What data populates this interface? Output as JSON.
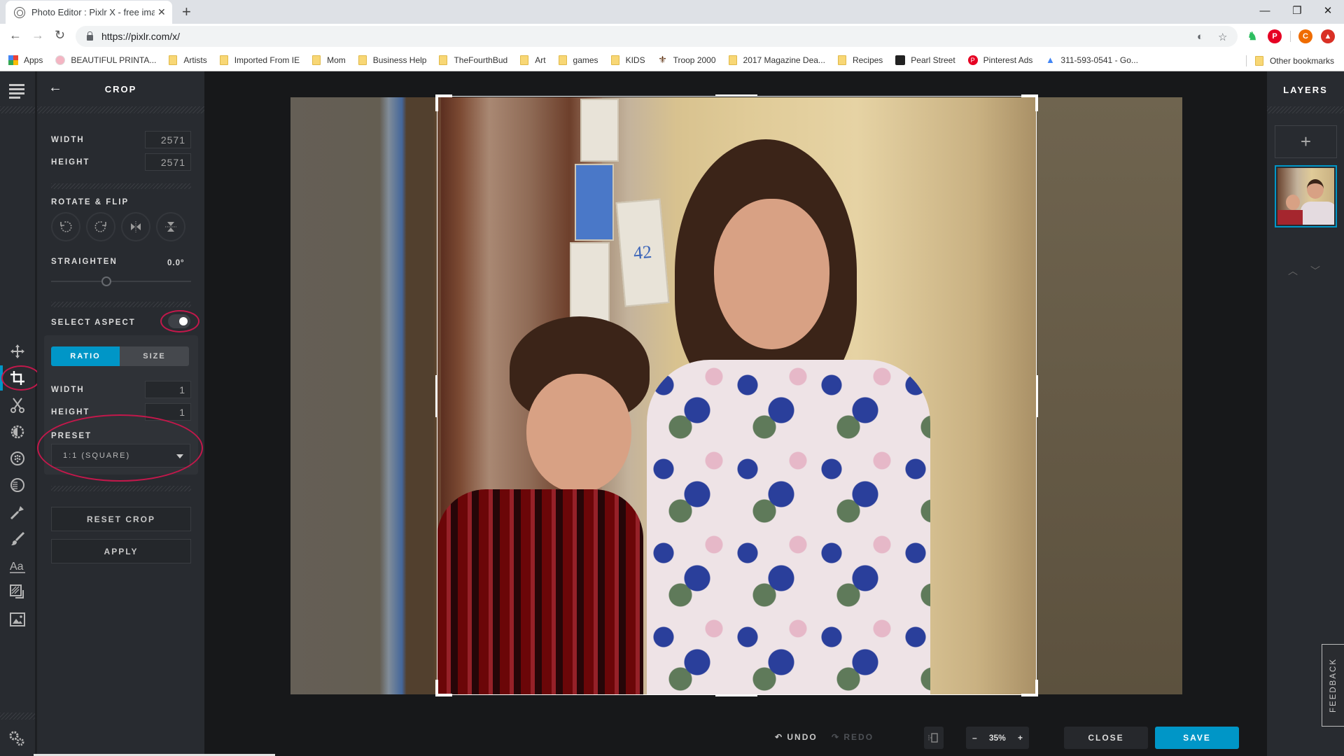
{
  "browser": {
    "tab_title": "Photo Editor : Pixlr X - free image",
    "url": "https://pixlr.com/x/",
    "bookmarks": [
      {
        "label": "Apps",
        "icon": "apps-grid-icon"
      },
      {
        "label": "BEAUTIFUL PRINTA...",
        "icon": "lotus-icon"
      },
      {
        "label": "Artists",
        "icon": "folder-icon"
      },
      {
        "label": "Imported From IE",
        "icon": "folder-icon"
      },
      {
        "label": "Mom",
        "icon": "folder-icon"
      },
      {
        "label": "Business Help",
        "icon": "folder-icon"
      },
      {
        "label": "TheFourthBud",
        "icon": "folder-icon"
      },
      {
        "label": "Art",
        "icon": "folder-icon"
      },
      {
        "label": "games",
        "icon": "folder-icon"
      },
      {
        "label": "KIDS",
        "icon": "folder-icon"
      },
      {
        "label": "Troop 2000",
        "icon": "fleur-de-lis-icon"
      },
      {
        "label": "2017 Magazine Dea...",
        "icon": "folder-icon"
      },
      {
        "label": "Recipes",
        "icon": "folder-icon"
      },
      {
        "label": "Pearl Street",
        "icon": "elephant-icon"
      },
      {
        "label": "Pinterest Ads",
        "icon": "pinterest-icon"
      },
      {
        "label": "311-593-0541 - Go...",
        "icon": "google-ads-icon"
      }
    ],
    "other_bookmarks": "Other bookmarks",
    "profile_initial": "C",
    "ext_colors": {
      "evernote": "#2dbe60",
      "pinterest": "#e60023",
      "profile": "#ef6c00",
      "update": "#d93025"
    }
  },
  "editor": {
    "accent_color": "#0096c7",
    "annotation_color": "#c2184b",
    "panel": {
      "title": "CROP",
      "width_label": "WIDTH",
      "width_value": "2571",
      "height_label": "HEIGHT",
      "height_value": "2571",
      "rotate_flip_label": "ROTATE & FLIP",
      "straighten_label": "STRAIGHTEN",
      "straighten_value": "0.0°",
      "straighten_fraction": 0.5,
      "select_aspect_label": "SELECT ASPECT",
      "select_aspect_on": true,
      "tabs": {
        "ratio": "RATIO",
        "size": "SIZE",
        "active": "ratio"
      },
      "ratio_width_label": "WIDTH",
      "ratio_width_value": "1",
      "ratio_height_label": "HEIGHT",
      "ratio_height_value": "1",
      "preset_label": "PRESET",
      "preset_value": "1:1 (SQUARE)",
      "reset_label": "RESET CROP",
      "apply_label": "APPLY"
    },
    "tools": [
      {
        "name": "arrange",
        "icon": "move-arrows-icon"
      },
      {
        "name": "crop",
        "icon": "crop-icon",
        "active": true
      },
      {
        "name": "cutout",
        "icon": "scissors-icon"
      },
      {
        "name": "adjust",
        "icon": "adjust-icon"
      },
      {
        "name": "filter",
        "icon": "filter-icon"
      },
      {
        "name": "effect",
        "icon": "effect-icon"
      },
      {
        "name": "retouch",
        "icon": "retouch-icon"
      },
      {
        "name": "draw",
        "icon": "brush-icon"
      },
      {
        "name": "text",
        "icon": "text-icon"
      },
      {
        "name": "elements",
        "icon": "elements-icon"
      },
      {
        "name": "add-image",
        "icon": "image-icon"
      }
    ],
    "photo": {
      "house_number": "42"
    },
    "bottom": {
      "undo_label": "UNDO",
      "redo_label": "REDO",
      "zoom_minus": "–",
      "zoom_value": "35%",
      "zoom_plus": "+",
      "close_label": "CLOSE",
      "save_label": "SAVE"
    },
    "layers": {
      "title": "LAYERS",
      "add_label": "+"
    },
    "feedback_label": "FEEDBACK"
  }
}
